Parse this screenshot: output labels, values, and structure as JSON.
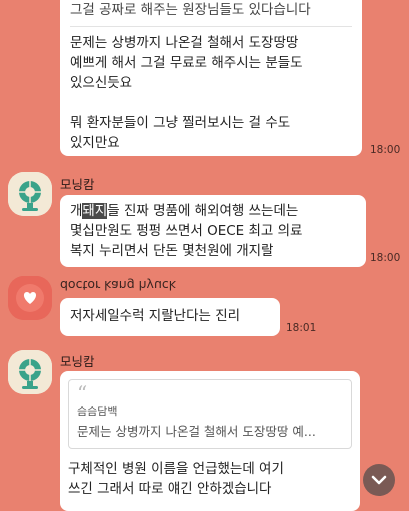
{
  "messages": {
    "m1": {
      "top_fragment": "그걸 공짜로 해주는 원장님들도 있다습니다",
      "lines": [
        "문제는 상병까지 나온걸 철해서 도장땅땅",
        "예쁘게 해서 그걸 무료로 해주시는 분들도",
        "있으신듯요",
        "",
        "뭐 환자분들이 그냥 찔러보시는 걸 수도",
        "있지만요"
      ],
      "time": "18:00"
    },
    "m2": {
      "sender": "모닝캄",
      "line1_pre": "개",
      "line1_highlight": "돼지",
      "line1_post": "들 진짜 명품에 해외여행 쓰는데는",
      "lines": [
        "몇십만원도 펑펑 쓰면서 OECE 최고 의료",
        "복지 누리면서 단돈 몇천원에 개지랄"
      ],
      "time": "18:00"
    },
    "m3": {
      "sender": "doctor kang hyuck",
      "text": "저자세일수럭 지랄난다는 진리",
      "time": "18:01"
    },
    "m4": {
      "sender": "모닝캄",
      "quote_mark": "“",
      "quote_author": "슴슴담백",
      "quote_text": "문제는 상병까지 나온걸 철해서 도장땅땅 예...",
      "lines": [
        "구체적인 병원 이름을 언급했는데 여기",
        "쓰긴 그래서 따로 얘긴 안하겠습니다"
      ]
    }
  },
  "icons": {
    "avatar_morning": "fan-avatar-icon",
    "avatar_doctor": "heart-avatar-icon",
    "scroll": "chevron-down-icon"
  },
  "colors": {
    "background": "#e9816f",
    "bubble": "#ffffff",
    "highlight": "#4a4a4a"
  }
}
